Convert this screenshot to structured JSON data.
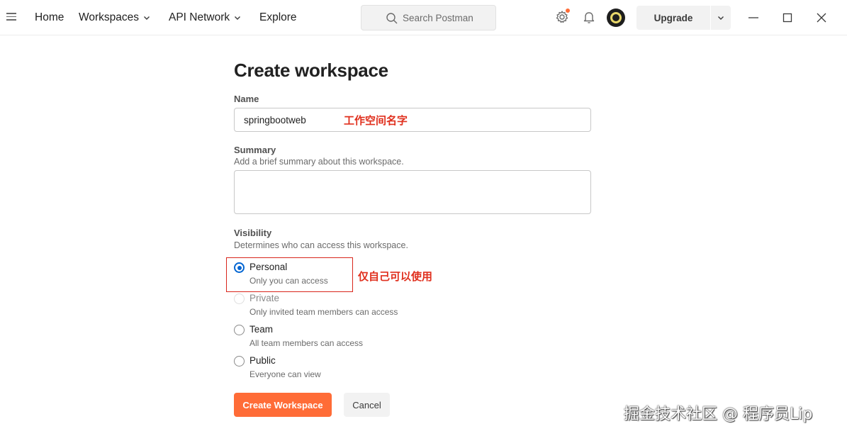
{
  "topbar": {
    "nav": [
      {
        "label": "Home"
      },
      {
        "label": "Workspaces"
      },
      {
        "label": "API Network"
      },
      {
        "label": "Explore"
      }
    ],
    "search_placeholder": "Search Postman",
    "upgrade_label": "Upgrade"
  },
  "form": {
    "title": "Create workspace",
    "name_label": "Name",
    "name_value": "springbootweb",
    "name_annotation": "工作空间名字",
    "summary_label": "Summary",
    "summary_help": "Add a brief summary about this workspace.",
    "summary_value": "",
    "visibility_label": "Visibility",
    "visibility_help": "Determines who can access this workspace.",
    "visibility_annotation": "仅自己可以使用",
    "options": [
      {
        "title": "Personal",
        "desc": "Only you can access",
        "selected": true,
        "disabled": false
      },
      {
        "title": "Private",
        "desc": "Only invited team members can access",
        "selected": false,
        "disabled": true
      },
      {
        "title": "Team",
        "desc": "All team members can access",
        "selected": false,
        "disabled": false
      },
      {
        "title": "Public",
        "desc": "Everyone can view",
        "selected": false,
        "disabled": false
      }
    ],
    "create_button": "Create Workspace",
    "cancel_button": "Cancel"
  },
  "watermark": "掘金技术社区 @ 程序员Lip",
  "colors": {
    "accent": "#ff6c37",
    "radio_selected": "#0265d2",
    "annotation": "#e0301e"
  }
}
